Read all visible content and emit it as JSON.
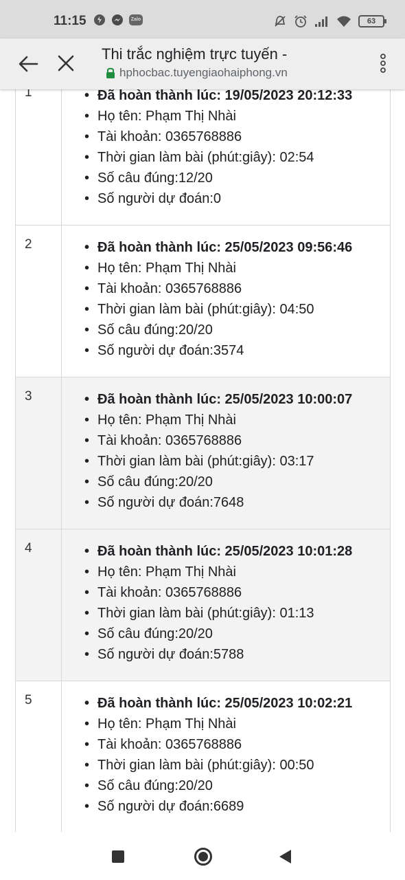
{
  "status_bar": {
    "time": "11:15",
    "battery": "63",
    "icons": [
      "shield-icon",
      "messenger-icon",
      "zalo-icon",
      "alarm-off-icon",
      "alarm-icon",
      "signal-icon",
      "wifi-icon",
      "battery-icon"
    ],
    "zalo_text": "Zalo"
  },
  "browser": {
    "title": "Thi trắc nghiệm trực tuyến -",
    "url": "hphocbac.tuyengiaohaiphong.vn"
  },
  "results": [
    {
      "index": "1",
      "completed": "Đã hoàn thành lúc: 19/05/2023 20:12:33",
      "name": "Họ tên: Phạm Thị Nhài",
      "account": "Tài khoản: 0365768886",
      "duration": "Thời gian làm bài (phút:giây): 02:54",
      "correct": "Số câu đúng:12/20",
      "predicted": "Số người dự đoán:0"
    },
    {
      "index": "2",
      "completed": "Đã hoàn thành lúc: 25/05/2023 09:56:46",
      "name": "Họ tên: Phạm Thị Nhài",
      "account": "Tài khoản: 0365768886",
      "duration": "Thời gian làm bài (phút:giây): 04:50",
      "correct": "Số câu đúng:20/20",
      "predicted": "Số người dự đoán:3574"
    },
    {
      "index": "3",
      "completed": "Đã hoàn thành lúc: 25/05/2023 10:00:07",
      "name": "Họ tên: Phạm Thị Nhài",
      "account": "Tài khoản: 0365768886",
      "duration": "Thời gian làm bài (phút:giây): 03:17",
      "correct": "Số câu đúng:20/20",
      "predicted": "Số người dự đoán:7648"
    },
    {
      "index": "4",
      "completed": "Đã hoàn thành lúc: 25/05/2023 10:01:28",
      "name": "Họ tên: Phạm Thị Nhài",
      "account": "Tài khoản: 0365768886",
      "duration": "Thời gian làm bài (phút:giây): 01:13",
      "correct": "Số câu đúng:20/20",
      "predicted": "Số người dự đoán:5788"
    },
    {
      "index": "5",
      "completed": "Đã hoàn thành lúc: 25/05/2023 10:02:21",
      "name": "Họ tên: Phạm Thị Nhài",
      "account": "Tài khoản: 0365768886",
      "duration": "Thời gian làm bài (phút:giây): 00:50",
      "correct": "Số câu đúng:20/20",
      "predicted": "Số người dự đoán:6689"
    }
  ],
  "colors": {
    "status_bar_bg": "#dcdcdc",
    "toolbar_bg": "#eeeeee",
    "lock_green": "#1e8e3e",
    "row_alt_bg": "#f3f3f3"
  }
}
